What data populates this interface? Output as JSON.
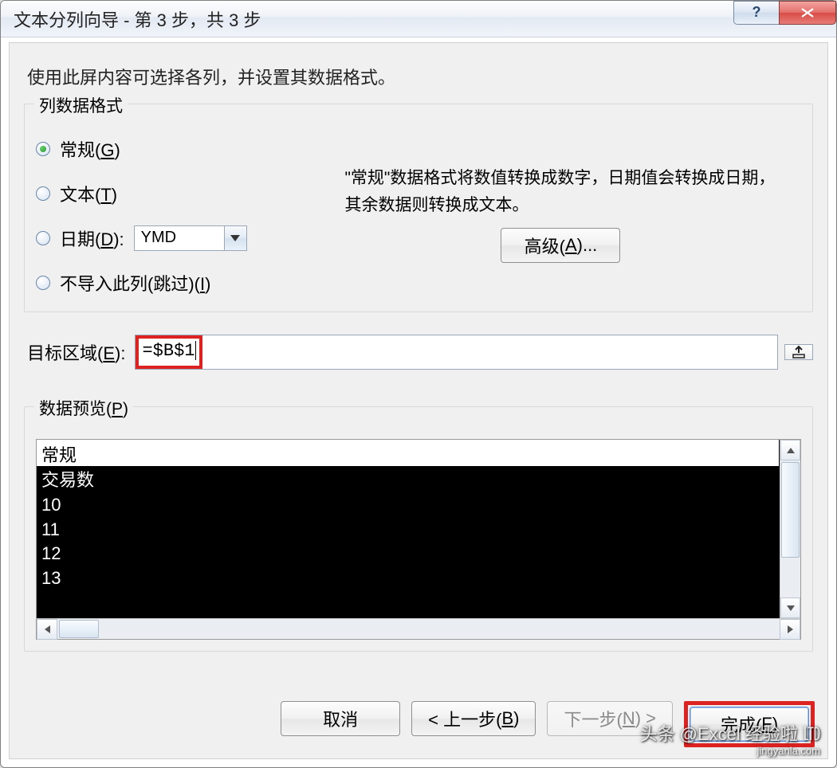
{
  "title": "文本分列向导 - 第 3 步，共 3 步",
  "instruction": "使用此屏内容可选择各列，并设置其数据格式。",
  "format_group": {
    "title": "列数据格式",
    "radios": {
      "general": {
        "label_pre": "常规(",
        "hot": "G",
        "label_post": ")"
      },
      "text": {
        "label_pre": "文本(",
        "hot": "T",
        "label_post": ")"
      },
      "date": {
        "label_pre": "日期(",
        "hot": "D",
        "label_post": "):"
      },
      "skip": {
        "label_pre": "不导入此列(跳过)(",
        "hot": "I",
        "label_post": ")"
      }
    },
    "date_combo": "YMD",
    "info": "\"常规\"数据格式将数值转换成数字，日期值会转换成日期，其余数据则转换成文本。",
    "advanced": {
      "label_pre": "高级(",
      "hot": "A",
      "label_post": ")..."
    }
  },
  "destination": {
    "label_pre": "目标区域(",
    "hot": "E",
    "label_post": "):",
    "value": "=$B$1"
  },
  "preview": {
    "title_pre": "数据预览(",
    "hot": "P",
    "title_post": ")",
    "column_header": "常规",
    "rows": [
      "交易数",
      "10",
      "11",
      "12",
      "13"
    ]
  },
  "buttons": {
    "cancel": "取消",
    "back": {
      "label_pre": "< 上一步(",
      "hot": "B",
      "label_post": ")"
    },
    "next": {
      "label_pre": "下一步(",
      "hot": "N",
      "label_post": ") >"
    },
    "finish": {
      "label_pre": "完成(",
      "hot": "F",
      "label_post": ")"
    }
  },
  "watermark": {
    "line1": "头条 @Excel 经验啦 ㋏",
    "line2": "jingyanla.com"
  }
}
